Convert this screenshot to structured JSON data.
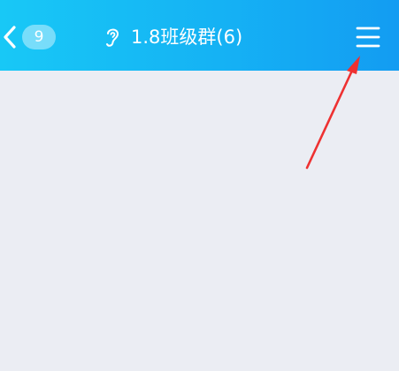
{
  "header": {
    "back_icon": "chevron-left-icon",
    "unread_count": "9",
    "voice_icon": "ear-icon",
    "title": "1.8班级群(6)",
    "menu_icon": "menu-icon"
  },
  "annotation": {
    "type": "arrow",
    "color": "#ee3131",
    "points_to": "menu-button"
  },
  "colors": {
    "header_gradient_start": "#18c8f6",
    "header_gradient_end": "#139cf2",
    "content_background": "#ebedf3",
    "text": "#ffffff"
  }
}
